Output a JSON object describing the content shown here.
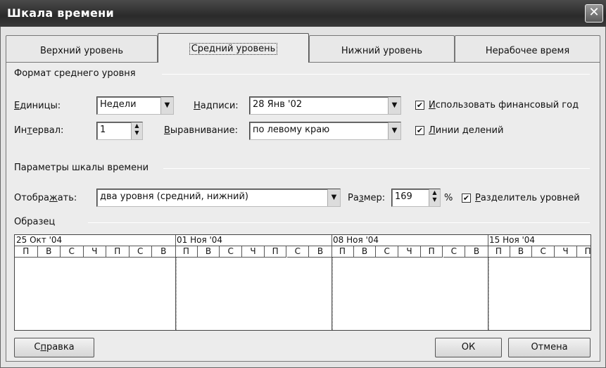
{
  "title": "Шкала времени",
  "close_glyph": "✕",
  "tabs": [
    "Верхний уровень",
    "Средний уровень",
    "Нижний уровень",
    "Нерабочее время"
  ],
  "format_group": {
    "title": "Формат среднего уровня",
    "units_label": "Единицы:",
    "units_value": "Недели",
    "captions_label": "Надписи:",
    "captions_value": "28 Янв '02",
    "fiscal_label": "Использовать финансовый год",
    "fiscal_checked": true,
    "interval_label": "Интервал:",
    "interval_value": "1",
    "align_label": "Выравнивание:",
    "align_value": "по левому краю",
    "ticks_label": "Линии делений",
    "ticks_checked": true
  },
  "options_group": {
    "title": "Параметры шкалы времени",
    "show_label": "Отображать:",
    "show_value": "два уровня (средний, нижний)",
    "size_label": "Размер:",
    "size_value": "169",
    "percent": "%",
    "separator_label": "Разделитель уровней",
    "separator_checked": true
  },
  "sample": {
    "title": "Образец",
    "weeks": [
      "25 Окт '04",
      "01 Ноя '04",
      "08 Ноя '04",
      "15 Ноя '04"
    ],
    "days": [
      "П",
      "В",
      "С",
      "Ч",
      "П",
      "С",
      "В"
    ]
  },
  "buttons": {
    "help": "Справка",
    "ok": "ОК",
    "cancel": "Отмена"
  },
  "check_glyph": "✔"
}
